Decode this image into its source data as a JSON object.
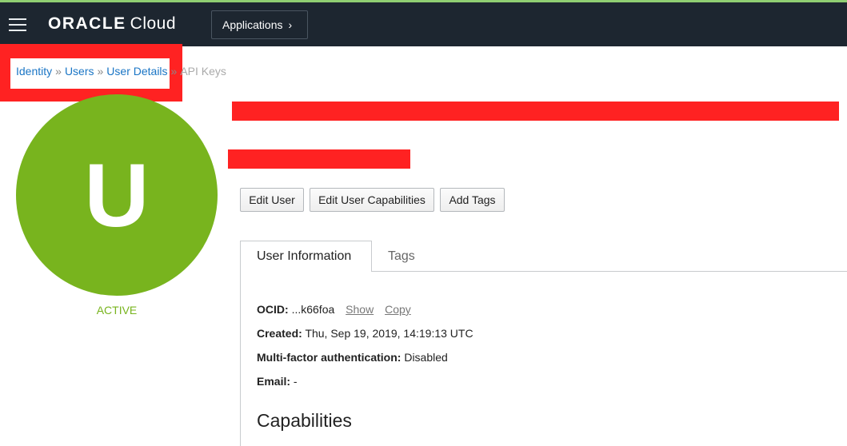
{
  "header": {
    "brand": "ORACLE",
    "product": "Cloud",
    "apps_label": "Applications",
    "apps_chevron": "›",
    "accent_color": "#8fce72",
    "bar_color": "#1d2630"
  },
  "breadcrumb": {
    "items": [
      "Identity",
      "Users",
      "User Details"
    ],
    "separator": "»",
    "current": "API Keys"
  },
  "user": {
    "initial": "U",
    "status": "ACTIVE",
    "avatar_color": "#78b41e"
  },
  "actions": {
    "edit_user": "Edit User",
    "edit_capabilities": "Edit User Capabilities",
    "add_tags": "Add Tags"
  },
  "tabs": {
    "user_info": "User Information",
    "tags": "Tags"
  },
  "details": {
    "ocid_label": "OCID:",
    "ocid_value": "...k66foa",
    "show_link": "Show",
    "copy_link": "Copy",
    "created_label": "Created:",
    "created_value": "Thu, Sep 19, 2019, 14:19:13 UTC",
    "mfa_label": "Multi-factor authentication:",
    "mfa_value": "Disabled",
    "email_label": "Email:",
    "email_value": "-"
  },
  "capabilities_heading": "Capabilities",
  "redaction_color": "#ff2222"
}
